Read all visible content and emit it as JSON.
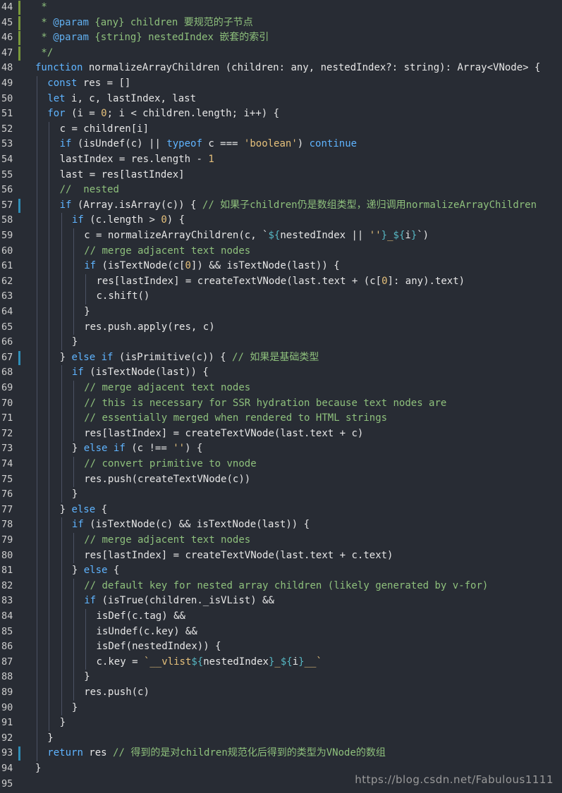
{
  "editor": {
    "background": "#282c34",
    "watermark": "https://blog.csdn.net/Fabulous1111",
    "lines": [
      {
        "n": "44",
        "indent": 0,
        "marker": "green",
        "tokens": [
          [
            "tk-doc",
            " *"
          ]
        ]
      },
      {
        "n": "45",
        "indent": 0,
        "marker": "green",
        "tokens": [
          [
            "tk-doc",
            " * "
          ],
          [
            "tk-tag",
            "@param"
          ],
          [
            "tk-doc",
            " {any} children 要规范的子节点"
          ]
        ]
      },
      {
        "n": "46",
        "indent": 0,
        "marker": "green",
        "tokens": [
          [
            "tk-doc",
            " * "
          ],
          [
            "tk-tag",
            "@param"
          ],
          [
            "tk-doc",
            " {string} nestedIndex 嵌套的索引"
          ]
        ]
      },
      {
        "n": "47",
        "indent": 0,
        "marker": "green",
        "tokens": [
          [
            "tk-doc",
            " */"
          ]
        ]
      },
      {
        "n": "48",
        "indent": 0,
        "tokens": [
          [
            "tk-kw",
            "function"
          ],
          [
            "tk-plain",
            " normalizeArrayChildren (children: any, nestedIndex?: string): Array<VNode> {"
          ]
        ]
      },
      {
        "n": "49",
        "indent": 1,
        "tokens": [
          [
            "tk-kw",
            "const"
          ],
          [
            "tk-plain",
            " res = []"
          ]
        ]
      },
      {
        "n": "50",
        "indent": 1,
        "tokens": [
          [
            "tk-kw",
            "let"
          ],
          [
            "tk-plain",
            " i, c, lastIndex, last"
          ]
        ]
      },
      {
        "n": "51",
        "indent": 1,
        "tokens": [
          [
            "tk-kw",
            "for"
          ],
          [
            "tk-plain",
            " (i = "
          ],
          [
            "tk-num",
            "0"
          ],
          [
            "tk-plain",
            "; i < children.length; i++) {"
          ]
        ]
      },
      {
        "n": "52",
        "indent": 2,
        "tokens": [
          [
            "tk-plain",
            "c = children[i]"
          ]
        ]
      },
      {
        "n": "53",
        "indent": 2,
        "tokens": [
          [
            "tk-kw",
            "if"
          ],
          [
            "tk-plain",
            " (isUndef(c) || "
          ],
          [
            "tk-kw",
            "typeof"
          ],
          [
            "tk-plain",
            " c === "
          ],
          [
            "tk-str",
            "'boolean'"
          ],
          [
            "tk-plain",
            ") "
          ],
          [
            "tk-kw",
            "continue"
          ]
        ]
      },
      {
        "n": "54",
        "indent": 2,
        "tokens": [
          [
            "tk-plain",
            "lastIndex = res.length - "
          ],
          [
            "tk-num",
            "1"
          ]
        ]
      },
      {
        "n": "55",
        "indent": 2,
        "tokens": [
          [
            "tk-plain",
            "last = res[lastIndex]"
          ]
        ]
      },
      {
        "n": "56",
        "indent": 2,
        "tokens": [
          [
            "tk-cm",
            "//  nested"
          ]
        ]
      },
      {
        "n": "57",
        "indent": 2,
        "marker": "blue",
        "tokens": [
          [
            "tk-kw",
            "if"
          ],
          [
            "tk-plain",
            " (Array.isArray(c)) { "
          ],
          [
            "tk-cm",
            "// 如果子children仍是数组类型，递归调用normalizeArrayChildren"
          ]
        ]
      },
      {
        "n": "58",
        "indent": 3,
        "tokens": [
          [
            "tk-kw",
            "if"
          ],
          [
            "tk-plain",
            " (c.length > "
          ],
          [
            "tk-num",
            "0"
          ],
          [
            "tk-plain",
            ") {"
          ]
        ]
      },
      {
        "n": "59",
        "indent": 4,
        "tokens": [
          [
            "tk-plain",
            "c = normalizeArrayChildren(c, `"
          ],
          [
            "tk-tmpl",
            "${"
          ],
          [
            "tk-plain",
            "nestedIndex || "
          ],
          [
            "tk-str",
            "''"
          ],
          [
            "tk-tmpl",
            "}"
          ],
          [
            "tk-str",
            "_"
          ],
          [
            "tk-tmpl",
            "${"
          ],
          [
            "tk-plain",
            "i"
          ],
          [
            "tk-tmpl",
            "}"
          ],
          [
            "tk-plain",
            "`)"
          ]
        ]
      },
      {
        "n": "60",
        "indent": 4,
        "tokens": [
          [
            "tk-cm",
            "// merge adjacent text nodes"
          ]
        ]
      },
      {
        "n": "61",
        "indent": 4,
        "tokens": [
          [
            "tk-kw",
            "if"
          ],
          [
            "tk-plain",
            " (isTextNode(c["
          ],
          [
            "tk-num",
            "0"
          ],
          [
            "tk-plain",
            "]) && isTextNode(last)) {"
          ]
        ]
      },
      {
        "n": "62",
        "indent": 5,
        "tokens": [
          [
            "tk-plain",
            "res[lastIndex] = createTextVNode(last.text + (c["
          ],
          [
            "tk-num",
            "0"
          ],
          [
            "tk-plain",
            "]: any).text)"
          ]
        ]
      },
      {
        "n": "63",
        "indent": 5,
        "tokens": [
          [
            "tk-plain",
            "c.shift()"
          ]
        ]
      },
      {
        "n": "64",
        "indent": 4,
        "tokens": [
          [
            "tk-plain",
            "}"
          ]
        ]
      },
      {
        "n": "65",
        "indent": 4,
        "tokens": [
          [
            "tk-plain",
            "res.push.apply(res, c)"
          ]
        ]
      },
      {
        "n": "66",
        "indent": 3,
        "tokens": [
          [
            "tk-plain",
            "}"
          ]
        ]
      },
      {
        "n": "67",
        "indent": 2,
        "marker": "blue",
        "tokens": [
          [
            "tk-plain",
            "} "
          ],
          [
            "tk-kw",
            "else if"
          ],
          [
            "tk-plain",
            " (isPrimitive(c)) { "
          ],
          [
            "tk-cm",
            "// 如果是基础类型"
          ]
        ]
      },
      {
        "n": "68",
        "indent": 3,
        "tokens": [
          [
            "tk-kw",
            "if"
          ],
          [
            "tk-plain",
            " (isTextNode(last)) {"
          ]
        ]
      },
      {
        "n": "69",
        "indent": 4,
        "tokens": [
          [
            "tk-cm",
            "// merge adjacent text nodes"
          ]
        ]
      },
      {
        "n": "70",
        "indent": 4,
        "tokens": [
          [
            "tk-cm",
            "// this is necessary for SSR hydration because text nodes are"
          ]
        ]
      },
      {
        "n": "71",
        "indent": 4,
        "tokens": [
          [
            "tk-cm",
            "// essentially merged when rendered to HTML strings"
          ]
        ]
      },
      {
        "n": "72",
        "indent": 4,
        "tokens": [
          [
            "tk-plain",
            "res[lastIndex] = createTextVNode(last.text + c)"
          ]
        ]
      },
      {
        "n": "73",
        "indent": 3,
        "tokens": [
          [
            "tk-plain",
            "} "
          ],
          [
            "tk-kw",
            "else if"
          ],
          [
            "tk-plain",
            " (c !== "
          ],
          [
            "tk-str",
            "''"
          ],
          [
            "tk-plain",
            ") {"
          ]
        ]
      },
      {
        "n": "74",
        "indent": 4,
        "tokens": [
          [
            "tk-cm",
            "// convert primitive to vnode"
          ]
        ]
      },
      {
        "n": "75",
        "indent": 4,
        "tokens": [
          [
            "tk-plain",
            "res.push(createTextVNode(c))"
          ]
        ]
      },
      {
        "n": "76",
        "indent": 3,
        "tokens": [
          [
            "tk-plain",
            "}"
          ]
        ]
      },
      {
        "n": "77",
        "indent": 2,
        "tokens": [
          [
            "tk-plain",
            "} "
          ],
          [
            "tk-kw",
            "else"
          ],
          [
            "tk-plain",
            " {"
          ]
        ]
      },
      {
        "n": "78",
        "indent": 3,
        "tokens": [
          [
            "tk-kw",
            "if"
          ],
          [
            "tk-plain",
            " (isTextNode(c) && isTextNode(last)) {"
          ]
        ]
      },
      {
        "n": "79",
        "indent": 4,
        "tokens": [
          [
            "tk-cm",
            "// merge adjacent text nodes"
          ]
        ]
      },
      {
        "n": "80",
        "indent": 4,
        "tokens": [
          [
            "tk-plain",
            "res[lastIndex] = createTextVNode(last.text + c.text)"
          ]
        ]
      },
      {
        "n": "81",
        "indent": 3,
        "tokens": [
          [
            "tk-plain",
            "} "
          ],
          [
            "tk-kw",
            "else"
          ],
          [
            "tk-plain",
            " {"
          ]
        ]
      },
      {
        "n": "82",
        "indent": 4,
        "tokens": [
          [
            "tk-cm",
            "// default key for nested array children (likely generated by v-for)"
          ]
        ]
      },
      {
        "n": "83",
        "indent": 4,
        "tokens": [
          [
            "tk-kw",
            "if"
          ],
          [
            "tk-plain",
            " (isTrue(children._isVList) &&"
          ]
        ]
      },
      {
        "n": "84",
        "indent": 5,
        "tokens": [
          [
            "tk-plain",
            "isDef(c.tag) &&"
          ]
        ]
      },
      {
        "n": "85",
        "indent": 5,
        "tokens": [
          [
            "tk-plain",
            "isUndef(c.key) &&"
          ]
        ]
      },
      {
        "n": "86",
        "indent": 5,
        "tokens": [
          [
            "tk-plain",
            "isDef(nestedIndex)) {"
          ]
        ]
      },
      {
        "n": "87",
        "indent": 5,
        "tokens": [
          [
            "tk-plain",
            "c.key = "
          ],
          [
            "tk-str",
            "`__vlist"
          ],
          [
            "tk-tmpl",
            "${"
          ],
          [
            "tk-plain",
            "nestedIndex"
          ],
          [
            "tk-tmpl",
            "}"
          ],
          [
            "tk-str",
            "_"
          ],
          [
            "tk-tmpl",
            "${"
          ],
          [
            "tk-plain",
            "i"
          ],
          [
            "tk-tmpl",
            "}"
          ],
          [
            "tk-str",
            "__`"
          ]
        ]
      },
      {
        "n": "88",
        "indent": 4,
        "tokens": [
          [
            "tk-plain",
            "}"
          ]
        ]
      },
      {
        "n": "89",
        "indent": 4,
        "tokens": [
          [
            "tk-plain",
            "res.push(c)"
          ]
        ]
      },
      {
        "n": "90",
        "indent": 3,
        "tokens": [
          [
            "tk-plain",
            "}"
          ]
        ]
      },
      {
        "n": "91",
        "indent": 2,
        "tokens": [
          [
            "tk-plain",
            "}"
          ]
        ]
      },
      {
        "n": "92",
        "indent": 1,
        "tokens": [
          [
            "tk-plain",
            "}"
          ]
        ]
      },
      {
        "n": "93",
        "indent": 1,
        "marker": "blue",
        "tokens": [
          [
            "tk-kw",
            "return"
          ],
          [
            "tk-plain",
            " res "
          ],
          [
            "tk-cm",
            "// 得到的是对children规范化后得到的类型为VNode的数组"
          ]
        ]
      },
      {
        "n": "94",
        "indent": 0,
        "tokens": [
          [
            "tk-plain",
            "}"
          ]
        ]
      },
      {
        "n": "95",
        "indent": 0,
        "tokens": []
      }
    ],
    "colors": {
      "marker_green": "#7a9a3a",
      "marker_blue": "#2f8fb8",
      "keyword": "#5fb4ff",
      "comment": "#8ec07c",
      "string": "#e5c07b"
    }
  }
}
